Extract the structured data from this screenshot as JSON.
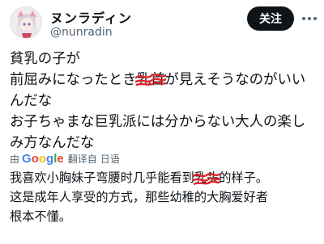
{
  "author": {
    "display_name": "ヌンラディン",
    "handle": "@nunradin"
  },
  "actions": {
    "follow_label": "关注",
    "more_icon": "more-horizontal-icon"
  },
  "tweet": {
    "lines": [
      "貧乳の子が",
      "前屈みになったとき乳首が見えそうなのがいい",
      "んだな",
      "お子ちゃまな巨乳派には分からない大人の楽し",
      "み方なんだな"
    ],
    "line2_before": "前屈みになったとき",
    "line2_redacted": "乳首",
    "line2_after": "が見えそうなのがいい"
  },
  "translation": {
    "prefix": "由",
    "provider": "Google",
    "action_label": "翻译自",
    "source_lang": "日语",
    "line1_before": "我喜欢小胸妹子弯腰时几乎能看到",
    "line1_redacted": "乳头",
    "line1_after": "的样子。",
    "line2": "这是成年人享受的方式，那些幼稚的大胸爱好者",
    "line3": "根本不懂。"
  },
  "colors": {
    "follow_bg": "#0f1419",
    "redaction": "#e0242a",
    "secondary_text": "#536471"
  }
}
